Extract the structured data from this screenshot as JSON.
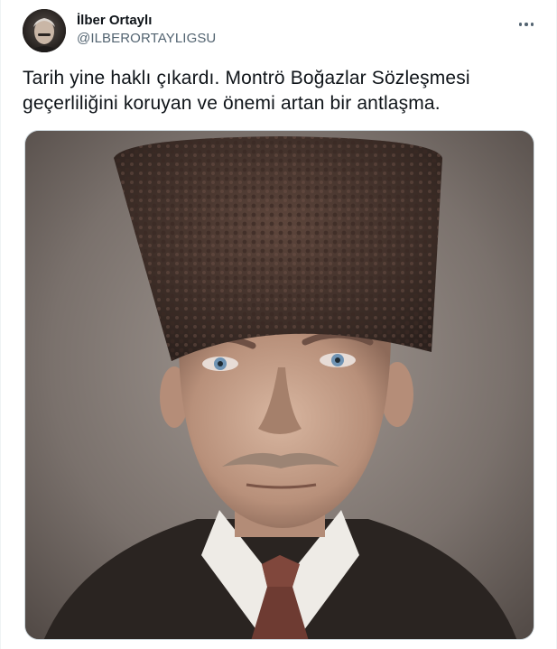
{
  "tweet": {
    "author": {
      "display_name": "İlber Ortaylı",
      "handle": "@ILBERORTAYLIGSU",
      "avatar_icon": "avatar-portrait"
    },
    "more_icon": "more-horizontal-icon",
    "text": "Tarih yine haklı çıkardı. Montrö Boğazlar Sözleşmesi geçerliliğini koruyan ve önemi artan bir antlaşma.",
    "media": {
      "kind": "portrait-photo"
    }
  },
  "colors": {
    "text_primary": "#0f1419",
    "text_secondary": "#536471",
    "border": "#cfd9de",
    "photo_background": "#6d6460"
  }
}
